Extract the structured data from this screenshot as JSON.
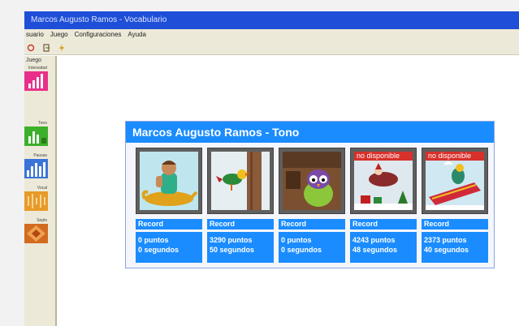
{
  "window": {
    "title": "Marcos Augusto Ramos - Vocabulario"
  },
  "menu": [
    "suario",
    "Juego",
    "Configuraciones",
    "Ayuda"
  ],
  "toolbar": [
    "open-icon",
    "exit-icon",
    "lightning-icon"
  ],
  "sidebar": {
    "header": "Juego",
    "items": [
      {
        "label": "Intensidad",
        "icon": "pink-bars-icon",
        "color": "#e8308a"
      },
      {
        "label": "Tono",
        "icon": "green-bars-icon",
        "color": "#3cb02a"
      },
      {
        "label": "Pausas",
        "icon": "blue-bars-icon",
        "color": "#3a74d8"
      },
      {
        "label": "Vocal",
        "icon": "orange-wave-icon",
        "color": "#e89a28"
      },
      {
        "label": "Soplo",
        "icon": "diamond-icon",
        "color": "#d26b20"
      }
    ]
  },
  "dialog": {
    "title": "Marcos Augusto Ramos - Tono",
    "record_label": "Record",
    "not_available": "no disponible",
    "games": [
      {
        "scene": "genie-on-lamp",
        "available": true,
        "points": "0 puntos",
        "seconds": "0 segundos"
      },
      {
        "scene": "woodpecker-on-tree",
        "available": true,
        "points": "3290 puntos",
        "seconds": "50 segundos"
      },
      {
        "scene": "green-owl-in-cave",
        "available": true,
        "points": "0 puntos",
        "seconds": "0 segundos"
      },
      {
        "scene": "santa-sleigh-gifts",
        "available": false,
        "points": "4243 puntos",
        "seconds": "48 segundos"
      },
      {
        "scene": "bird-on-flying-carpet",
        "available": false,
        "points": "2373 puntos",
        "seconds": "40 segundos"
      }
    ]
  },
  "colors": {
    "accent": "#1a8cff",
    "titlebar": "#1f4fd8",
    "unavailable": "#d8302a"
  }
}
